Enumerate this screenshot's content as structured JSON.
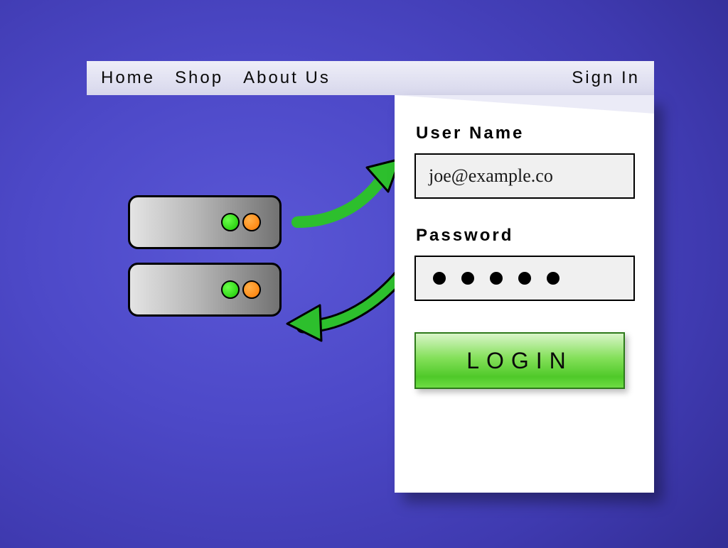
{
  "nav": {
    "items": [
      "Home",
      "Shop",
      "About Us"
    ],
    "sign_in": "Sign In"
  },
  "login": {
    "username_label": "User Name",
    "username_value": "joe@example.co",
    "password_label": "Password",
    "password_dots": 5,
    "button": "LOGIN"
  },
  "colors": {
    "led_green": "#18c400",
    "led_orange": "#ff7a00",
    "button_green": "#4fc929",
    "arrow_green": "#2dbf2d"
  }
}
